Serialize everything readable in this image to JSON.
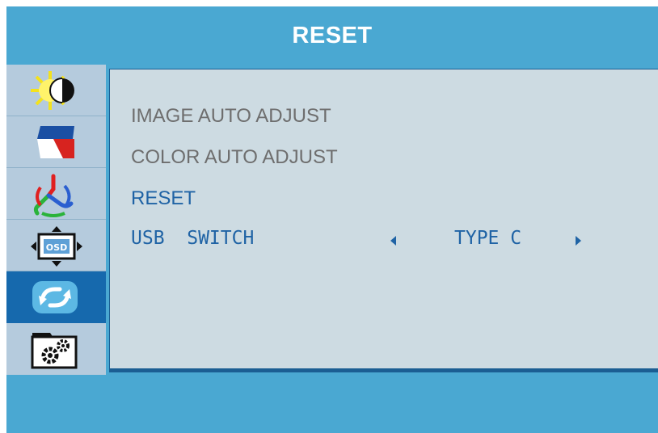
{
  "title": "RESET",
  "sidebar": {
    "items": [
      {
        "icon": "brightness-contrast-icon"
      },
      {
        "icon": "color-flag-icon"
      },
      {
        "icon": "rgb-color-icon"
      },
      {
        "icon": "osd-settings-icon"
      },
      {
        "icon": "reset-arrows-icon",
        "active": true
      },
      {
        "icon": "gear-settings-icon"
      }
    ]
  },
  "menu": {
    "items": [
      {
        "label": "IMAGE AUTO ADJUST"
      },
      {
        "label": "COLOR AUTO ADJUST"
      },
      {
        "label": "RESET",
        "selected": true
      },
      {
        "label": "USB  SWITCH",
        "value": "TYPE C"
      }
    ]
  },
  "colors": {
    "frame": "#4aa8d2",
    "sidebar": "#b5cbdd",
    "active": "#1669ad",
    "content": "#cddbe2",
    "text_dim": "#6e6e6e",
    "text_selected": "#1f63a5"
  }
}
